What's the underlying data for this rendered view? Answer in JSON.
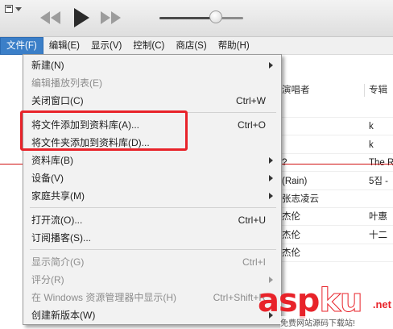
{
  "menubar": {
    "items": [
      "文件(F)",
      "编辑(E)",
      "显示(V)",
      "控制(C)",
      "商店(S)",
      "帮助(H)"
    ]
  },
  "file_menu": {
    "items": [
      {
        "label": "新建(N)",
        "shortcut": "",
        "submenu": true,
        "disabled": false
      },
      {
        "label": "编辑播放列表(E)",
        "shortcut": "",
        "submenu": false,
        "disabled": true
      },
      {
        "label": "关闭窗口(C)",
        "shortcut": "Ctrl+W",
        "submenu": false,
        "disabled": false
      },
      {
        "label": "将文件添加到资料库(A)...",
        "shortcut": "Ctrl+O",
        "submenu": false,
        "disabled": false
      },
      {
        "label": "将文件夹添加到资料库(D)...",
        "shortcut": "",
        "submenu": false,
        "disabled": false
      },
      {
        "label": "资料库(B)",
        "shortcut": "",
        "submenu": true,
        "disabled": false
      },
      {
        "label": "设备(V)",
        "shortcut": "",
        "submenu": true,
        "disabled": false
      },
      {
        "label": "家庭共享(M)",
        "shortcut": "",
        "submenu": true,
        "disabled": false
      },
      {
        "label": "打开流(O)...",
        "shortcut": "Ctrl+U",
        "submenu": false,
        "disabled": false
      },
      {
        "label": "订阅播客(S)...",
        "shortcut": "",
        "submenu": false,
        "disabled": false
      },
      {
        "label": "显示简介(G)",
        "shortcut": "Ctrl+I",
        "submenu": false,
        "disabled": true
      },
      {
        "label": "评分(R)",
        "shortcut": "",
        "submenu": true,
        "disabled": true
      },
      {
        "label": "在 Windows 资源管理器中显示(H)",
        "shortcut": "Ctrl+Shift+R",
        "submenu": false,
        "disabled": true
      },
      {
        "label": "创建新版本(W)",
        "shortcut": "",
        "submenu": true,
        "disabled": false
      }
    ]
  },
  "library": {
    "columns": [
      "演唱者",
      "专辑"
    ],
    "rows": [
      {
        "artist": "",
        "album": ""
      },
      {
        "artist": "",
        "album": "k"
      },
      {
        "artist": "",
        "album": "k"
      },
      {
        "artist": "?",
        "album": "The R"
      },
      {
        "artist": "(Rain)",
        "album": "5집 -"
      },
      {
        "artist": "张志凌云",
        "album": ""
      },
      {
        "artist": "杰伦",
        "album": "叶惠"
      },
      {
        "artist": "杰伦",
        "album": "十二"
      },
      {
        "artist": "杰伦",
        "album": ""
      }
    ]
  },
  "player": {
    "volume_level": 0.67
  },
  "watermark": {
    "main_a": "asp",
    "main_b": "ku",
    "suffix": ".net",
    "sub": "免费网站源码下载站!"
  },
  "colors": {
    "menu_highlight": "#3b7fc8",
    "annotation_red": "#e8232a"
  }
}
